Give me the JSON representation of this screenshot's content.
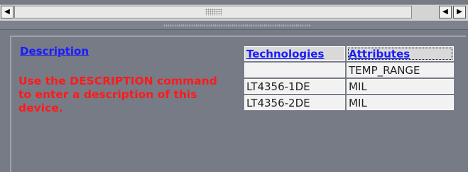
{
  "scrollbar": {
    "left_arrow": "◀",
    "right_arrow": "▶"
  },
  "description": {
    "title": "Description",
    "text": "Use the DESCRIPTION command to enter a description of this device."
  },
  "attributes_table": {
    "headers": [
      "Technologies",
      "Attributes"
    ],
    "rows": [
      [
        "",
        "TEMP_RANGE"
      ],
      [
        "LT4356-1DE",
        "MIL"
      ],
      [
        "LT4356-2DE",
        "MIL"
      ]
    ]
  }
}
